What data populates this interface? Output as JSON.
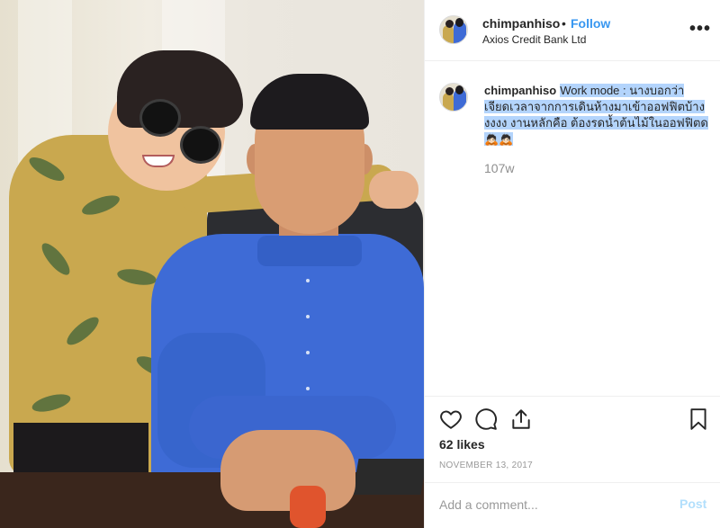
{
  "post": {
    "username": "chimpanhiso",
    "separator": "•",
    "follow_label": "Follow",
    "location": "Axios Credit Bank Ltd",
    "more_icon": "more-options-icon",
    "caption": "Work mode : นางบอกว่าเจียดเวลาจากการเดินห้างมาเข้าออฟฟิตบ้างงงงง งานหลักคือ ต้องรดน้ำต้นไม้ในออฟฟิตด 🙇🏻🙇🏻",
    "caption_age": "107w",
    "likes": "62 likes",
    "date": "November 13, 2017",
    "add_comment_placeholder": "Add a comment...",
    "post_label": "Post"
  },
  "icons": {
    "like": "heart-icon",
    "comment": "comment-icon",
    "share": "share-icon",
    "save": "bookmark-icon"
  },
  "colors": {
    "accent": "#3897f0",
    "post_disabled": "#b2dffc",
    "selection": "#b3d4fc",
    "meta_text": "#8e8e8e"
  }
}
